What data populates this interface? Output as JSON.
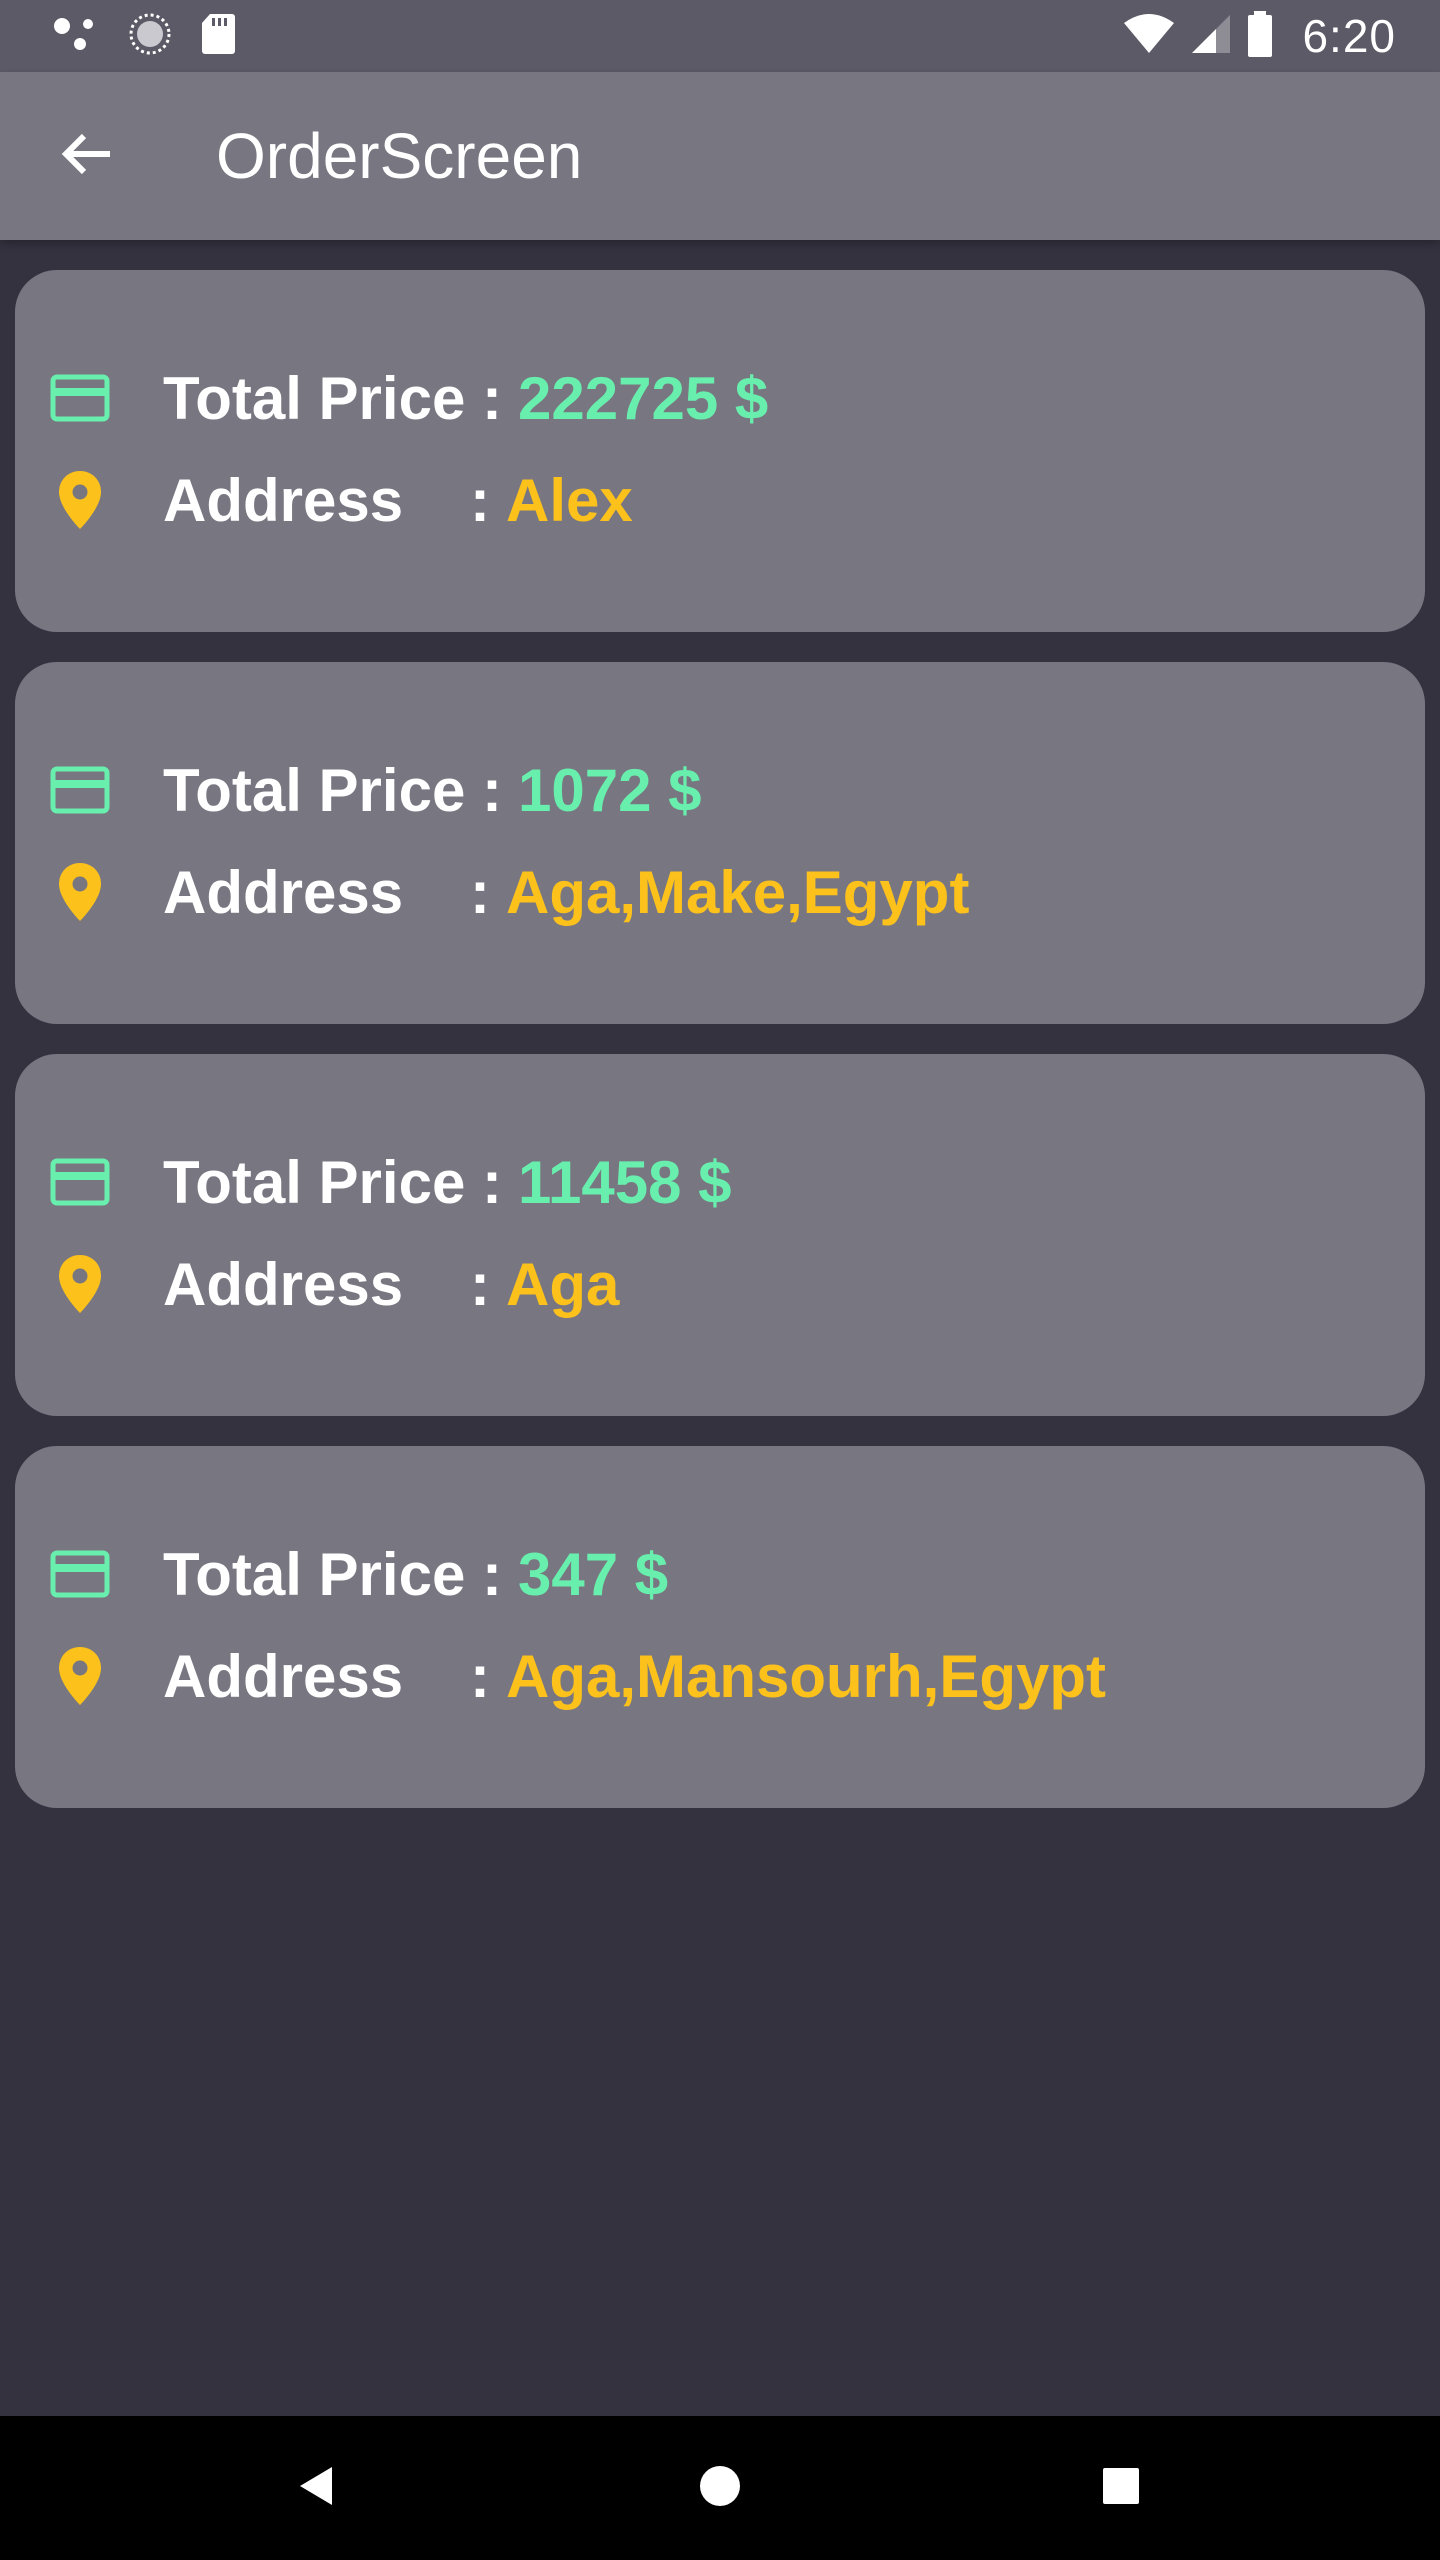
{
  "status_bar": {
    "time": "6:20",
    "left_icons": [
      "assistant-dots-icon",
      "sync-circle-icon",
      "sd-card-icon"
    ],
    "right_icons": [
      "wifi-icon",
      "signal-icon",
      "battery-icon"
    ]
  },
  "app_bar": {
    "title": "OrderScreen",
    "back_icon": "arrow-left-icon"
  },
  "orders": [
    {
      "price_label": "Total Price ",
      "price_sep": ":",
      "price_value": "222725 $",
      "address_label": "Address",
      "address_sep": ":",
      "address_value": "Alex"
    },
    {
      "price_label": "Total Price ",
      "price_sep": ":",
      "price_value": "1072 $",
      "address_label": "Address",
      "address_sep": ":",
      "address_value": "Aga,Make,Egypt"
    },
    {
      "price_label": "Total Price ",
      "price_sep": ":",
      "price_value": "11458 $",
      "address_label": "Address",
      "address_sep": ":",
      "address_value": "Aga"
    },
    {
      "price_label": "Total Price ",
      "price_sep": ":",
      "price_value": "347 $",
      "address_label": "Address",
      "address_sep": ":",
      "address_value": "Aga,Mansourh,Egypt"
    }
  ],
  "icons": {
    "price": "credit-card-icon",
    "address": "location-pin-icon"
  },
  "colors": {
    "background": "#34323f",
    "app_bar": "#787781",
    "card": "#787781",
    "price_accent": "#69efad",
    "address_accent": "#fcc11a",
    "status_bar": "#5b5a66"
  },
  "nav_bar": {
    "buttons": [
      "back-triangle-icon",
      "home-circle-icon",
      "recents-square-icon"
    ]
  }
}
